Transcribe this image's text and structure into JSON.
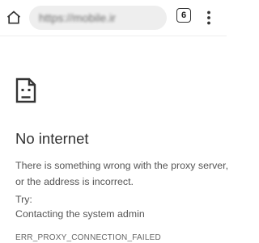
{
  "toolbar": {
    "home_icon": "home-icon",
    "url": "https://mobile.ir",
    "tab_count": "6",
    "tab_icon": "tab-switcher-icon",
    "menu_icon": "more-vert-icon"
  },
  "error_page": {
    "icon": "sad-document-icon",
    "title": "No internet",
    "description_line1": "There is something wrong with the proxy server,",
    "description_line2": "or the address is incorrect.",
    "try_label": "Try:",
    "suggestions": [
      "Contacting the system admin"
    ],
    "error_code": "ERR_PROXY_CONNECTION_FAILED"
  },
  "colors": {
    "text_primary": "#333333",
    "text_secondary": "#555555",
    "omnibox_bg": "#eeeeee",
    "page_bg": "#ffffff"
  }
}
